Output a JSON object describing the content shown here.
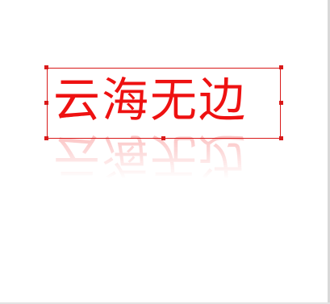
{
  "canvas": {
    "background": "#ffffff"
  },
  "text_object": {
    "content": "云海无边",
    "color": "#ee1111",
    "selection_color": "#d91a1a",
    "reflection": true
  }
}
